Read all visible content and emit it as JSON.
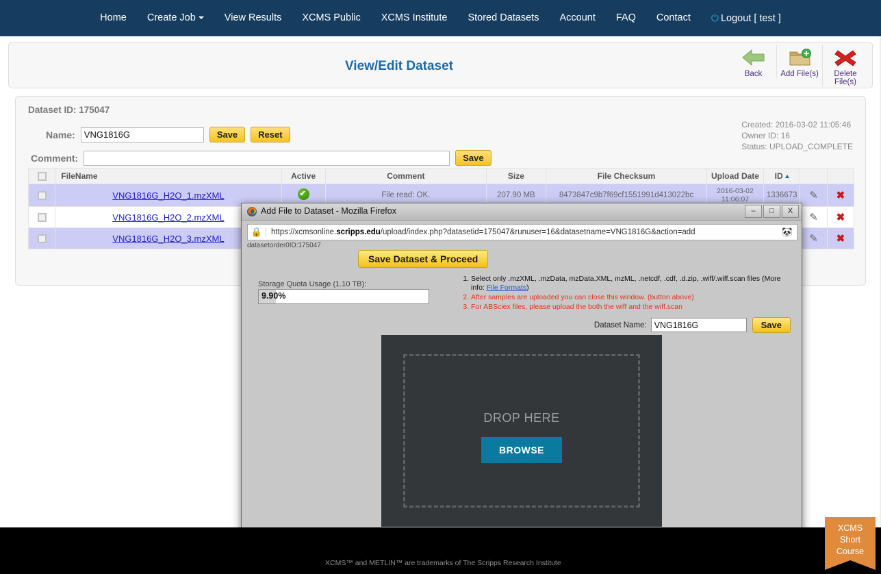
{
  "nav": {
    "items": [
      {
        "label": "Home",
        "caret": false
      },
      {
        "label": "Create Job",
        "caret": true
      },
      {
        "label": "View Results",
        "caret": false
      },
      {
        "label": "XCMS Public",
        "caret": false
      },
      {
        "label": "XCMS Institute",
        "caret": false
      },
      {
        "label": "Stored Datasets",
        "caret": false
      },
      {
        "label": "Account",
        "caret": false
      },
      {
        "label": "FAQ",
        "caret": false
      },
      {
        "label": "Contact",
        "caret": false
      }
    ],
    "logout": "Logout [ test ]",
    "power_icon": "power-icon",
    "bg_color": "#163d60"
  },
  "header": {
    "title": "View/Edit Dataset",
    "title_color": "#1a6aa8",
    "actions": [
      {
        "label": "Back",
        "icon": "back-arrow-icon"
      },
      {
        "label": "Add File(s)",
        "icon": "folder-add-icon"
      },
      {
        "label": "Delete File(s)",
        "icon": "red-x-icon"
      }
    ]
  },
  "dataset": {
    "id_label": "Dataset ID: 175047",
    "name_label": "Name:",
    "name_value": "VNG1816G",
    "name_save": "Save",
    "name_reset": "Reset",
    "comment_label": "Comment:",
    "comment_value": "",
    "comment_save": "Save",
    "created": "Created: 2016-03-02 11:05:46",
    "owner": "Owner ID: 16",
    "status": "Status: UPLOAD_COMPLETE"
  },
  "table": {
    "columns": [
      "FileName",
      "Active",
      "Comment",
      "Size",
      "File Checksum",
      "Upload Date",
      "ID"
    ],
    "sorted_column": "ID",
    "sort_direction": "asc",
    "rows": [
      {
        "filename": "VNG1816G_H2O_1.mzXML",
        "active": "active-check-icon",
        "comment": "File read: OK.",
        "size": "207.90 MB",
        "checksum": "8473847c9b7f69cf1551991d413022bc",
        "upload_date": "2016-03-02 11:06:07",
        "id": "1336673"
      },
      {
        "filename": "VNG1816G_H2O_2.mzXML",
        "active": "",
        "comment": "",
        "size": "",
        "checksum": "",
        "upload_date": "",
        "id": ""
      },
      {
        "filename": "VNG1816G_H2O_3.mzXML",
        "active": "",
        "comment": "",
        "size": "",
        "checksum": "",
        "upload_date": "",
        "id": ""
      }
    ]
  },
  "dialog": {
    "window_title": "Add File to Dataset - Mozilla Firefox",
    "window_buttons": {
      "minimize": "–",
      "maximize": "□",
      "close": "X"
    },
    "url_prefix": "https://xcmsonline.",
    "url_domain": "scripps.edu",
    "url_suffix": "/upload/index.php?datasetid=175047&runuser=16&datasetname=VNG1816G&action=add",
    "lock_icon": "padlock-icon",
    "extension_icon": "firefox-addon-icon",
    "order_text": "datasetorder0ID:175047",
    "save_proceed": "Save Dataset & Proceed",
    "quota_label": "Storage Quota Usage (1.10 TB):",
    "quota_value": "9.90",
    "quota_unit": "%",
    "instructions": [
      {
        "text": "Select only .mzXML, .mzData, mzData.XML, mzML, .netcdf, .cdf, .d.zip, .wiff/.wiff.scan files (More info: ",
        "link": "File Formats",
        "tail": ")",
        "warn": false
      },
      {
        "text": "After samples are uploaded you can close this window. (button above)",
        "link": "",
        "tail": "",
        "warn": true
      },
      {
        "text": "For ABSciex files, please upload the both the wiff and the wiff.scan",
        "link": "",
        "tail": "",
        "warn": true
      }
    ],
    "dataset_name_label": "Dataset Name:",
    "dataset_name_value": "VNG1816G",
    "dataset_name_save": "Save",
    "drop_text": "DROP HERE",
    "browse_label": "BROWSE",
    "browse_color": "#0a7a9e"
  },
  "footer": {
    "trademark": "XCMS™ and METLIN™ are trademarks of The Scripps Research Institute",
    "badge_line1": "XCMS",
    "badge_line2": "Short",
    "badge_line3": "Course",
    "badge_color": "#e08a3c"
  }
}
